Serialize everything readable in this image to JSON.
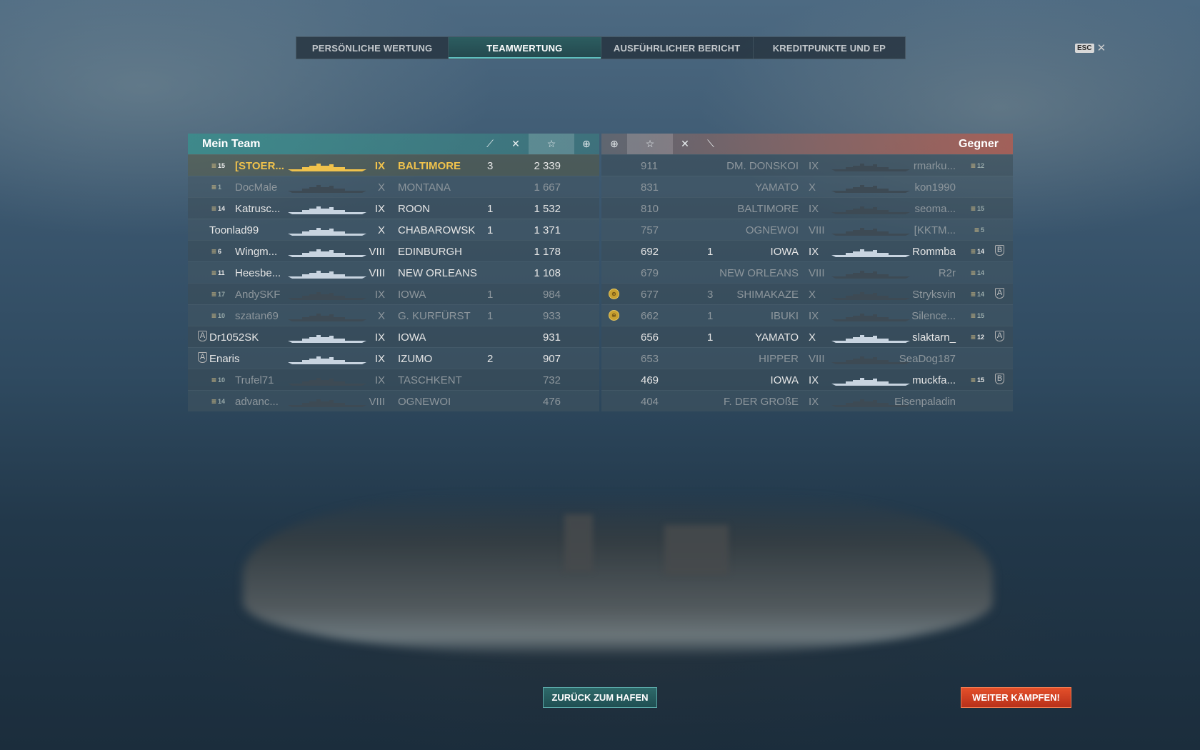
{
  "tabs": [
    {
      "label": "PERSÖNLICHE WERTUNG",
      "active": false
    },
    {
      "label": "TEAMWERTUNG",
      "active": true
    },
    {
      "label": "AUSFÜHRLICHER BERICHT",
      "active": false
    },
    {
      "label": "KREDITPUNKTE UND EP",
      "active": false
    }
  ],
  "esc_key": "ESC",
  "left_team": {
    "title": "Mein Team",
    "rows": [
      {
        "rank": "15",
        "name": "[STOER...",
        "tier": "IX",
        "ship": "BALTIMORE",
        "kills": "3",
        "score": "2 339",
        "me": true,
        "dead": false
      },
      {
        "rank": "1",
        "name": "DocMale",
        "tier": "X",
        "ship": "MONTANA",
        "kills": "",
        "score": "1 667",
        "me": false,
        "dead": true
      },
      {
        "rank": "14",
        "name": "Katrusc...",
        "tier": "IX",
        "ship": "ROON",
        "kills": "1",
        "score": "1 532",
        "me": false,
        "dead": false
      },
      {
        "rank": "",
        "name": "Toonlad99",
        "tier": "X",
        "ship": "CHABAROWSK",
        "kills": "1",
        "score": "1 371",
        "me": false,
        "dead": false
      },
      {
        "rank": "6",
        "name": "Wingm...",
        "tier": "VIII",
        "ship": "EDINBURGH",
        "kills": "",
        "score": "1 178",
        "me": false,
        "dead": false
      },
      {
        "rank": "11",
        "name": "Heesbe...",
        "tier": "VIII",
        "ship": "NEW ORLEANS",
        "kills": "",
        "score": "1 108",
        "me": false,
        "dead": false
      },
      {
        "rank": "17",
        "name": "AndySKF",
        "tier": "IX",
        "ship": "IOWA",
        "kills": "1",
        "score": "984",
        "me": false,
        "dead": true
      },
      {
        "rank": "10",
        "name": "szatan69",
        "tier": "X",
        "ship": "G. KURFÜRST",
        "kills": "1",
        "score": "933",
        "me": false,
        "dead": true
      },
      {
        "rank": "",
        "name": "Dr1052SK",
        "tier": "IX",
        "ship": "IOWA",
        "kills": "",
        "score": "931",
        "me": false,
        "dead": false,
        "badge": "A"
      },
      {
        "rank": "",
        "name": "Enaris",
        "tier": "IX",
        "ship": "IZUMO",
        "kills": "2",
        "score": "907",
        "me": false,
        "dead": false,
        "badge": "A"
      },
      {
        "rank": "10",
        "name": "Trufel71",
        "tier": "IX",
        "ship": "TASCHKENT",
        "kills": "",
        "score": "732",
        "me": false,
        "dead": true
      },
      {
        "rank": "14",
        "name": "advanc...",
        "tier": "VIII",
        "ship": "OGNEWOI",
        "kills": "",
        "score": "476",
        "me": false,
        "dead": true
      }
    ]
  },
  "right_team": {
    "title": "Gegner",
    "rows": [
      {
        "score": "911",
        "kills": "",
        "ship": "DM. DONSKOI",
        "tier": "IX",
        "name": "rmarku...",
        "rank": "12",
        "dead": true
      },
      {
        "score": "831",
        "kills": "",
        "ship": "YAMATO",
        "tier": "X",
        "name": "kon1990",
        "rank": "",
        "dead": true
      },
      {
        "score": "810",
        "kills": "",
        "ship": "BALTIMORE",
        "tier": "IX",
        "name": "seoma...",
        "rank": "15",
        "dead": true
      },
      {
        "score": "757",
        "kills": "",
        "ship": "OGNEWOI",
        "tier": "VIII",
        "name": "[KKTM...",
        "rank": "5",
        "dead": true
      },
      {
        "score": "692",
        "kills": "1",
        "ship": "IOWA",
        "tier": "IX",
        "name": "Rommba",
        "rank": "14",
        "dead": false,
        "badge": "B"
      },
      {
        "score": "679",
        "kills": "",
        "ship": "NEW ORLEANS",
        "tier": "VIII",
        "name": "R2r",
        "rank": "14",
        "dead": true
      },
      {
        "score": "677",
        "kills": "3",
        "ship": "SHIMAKAZE",
        "tier": "X",
        "name": "Stryksvin",
        "rank": "14",
        "dead": true,
        "medal": true,
        "badge": "A"
      },
      {
        "score": "662",
        "kills": "1",
        "ship": "IBUKI",
        "tier": "IX",
        "name": "Silence...",
        "rank": "15",
        "dead": true,
        "medal": true
      },
      {
        "score": "656",
        "kills": "1",
        "ship": "YAMATO",
        "tier": "X",
        "name": "slaktarn_",
        "rank": "12",
        "dead": false,
        "badge": "A"
      },
      {
        "score": "653",
        "kills": "",
        "ship": "HIPPER",
        "tier": "VIII",
        "name": "SeaDog187",
        "rank": "",
        "dead": true
      },
      {
        "score": "469",
        "kills": "",
        "ship": "IOWA",
        "tier": "IX",
        "name": "muckfa...",
        "rank": "15",
        "dead": false,
        "badge": "B"
      },
      {
        "score": "404",
        "kills": "",
        "ship": "F. DER GROßE",
        "tier": "IX",
        "name": "Eisenpaladin",
        "rank": "",
        "dead": true
      }
    ]
  },
  "buttons": {
    "back": "ZURÜCK ZUM HAFEN",
    "fight": "WEITER KÄMPFEN!"
  }
}
